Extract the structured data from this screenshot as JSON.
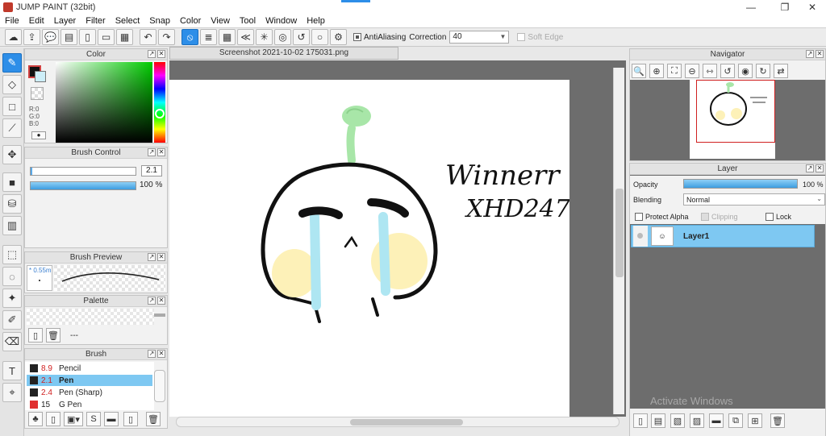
{
  "window": {
    "title": "JUMP PAINT (32bit)",
    "controls": [
      "—",
      "❐",
      "✕"
    ]
  },
  "menu": [
    "File",
    "Edit",
    "Layer",
    "Filter",
    "Select",
    "Snap",
    "Color",
    "View",
    "Tool",
    "Window",
    "Help"
  ],
  "toolbar": {
    "antialias_label": "AntiAliasing",
    "correction_label": "Correction",
    "correction_value": "40",
    "soft_edge_label": "Soft Edge"
  },
  "color_panel": {
    "title": "Color",
    "r": "R:0",
    "g": "G:0",
    "b": "B:0"
  },
  "brush_control": {
    "title": "Brush Control",
    "size_value": "2.1",
    "opacity_value": "100 %"
  },
  "brush_preview": {
    "title": "Brush Preview",
    "size": "* 0.55m"
  },
  "palette": {
    "title": "Palette",
    "placeholder": "---"
  },
  "brush_panel": {
    "title": "Brush",
    "items": [
      {
        "size": "8.9",
        "name": "Pencil",
        "color": "#222222"
      },
      {
        "size": "2.1",
        "name": "Pen",
        "color": "#222222"
      },
      {
        "size": "2.4",
        "name": "Pen (Sharp)",
        "color": "#222222"
      },
      {
        "size": "15",
        "name": "G Pen",
        "color": "#e03030"
      }
    ]
  },
  "canvas": {
    "tab_title": "Screenshot 2021-10-02 175031.png",
    "handwriting_1": "Winnerr",
    "handwriting_2": "XHD247"
  },
  "navigator": {
    "title": "Navigator"
  },
  "layer_panel": {
    "title": "Layer",
    "opacity_label": "Opacity",
    "opacity_value": "100 %",
    "blending_label": "Blending",
    "blending_value": "Normal",
    "protect_alpha": "Protect Alpha",
    "clipping": "Clipping",
    "lock": "Lock",
    "layer_name": "Layer1"
  },
  "watermark": "Activate Windows",
  "colors": {
    "accent": "#2d8ee8",
    "selection": "#7ec8f2"
  }
}
